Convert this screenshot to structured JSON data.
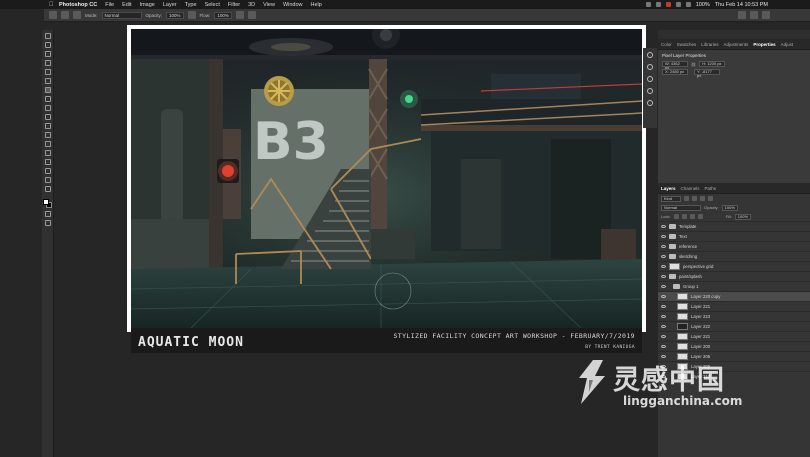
{
  "menubar": {
    "app_name": "Photoshop CC",
    "items": [
      "File",
      "Edit",
      "Image",
      "Layer",
      "Type",
      "Select",
      "Filter",
      "3D",
      "View",
      "Window",
      "Help"
    ],
    "battery": "100%",
    "clock": "Thu Feb 14  10:53 PM"
  },
  "options_bar": {
    "mode_label": "Mode:",
    "mode_value": "Normal",
    "opacity_label": "Opacity:",
    "opacity_value": "100%",
    "flow_label": "Flow:",
    "flow_value": "100%"
  },
  "artwork": {
    "title": "AQUATIC MOON",
    "subtitle": "STYLIZED FACILITY CONCEPT ART WORKSHOP - FEBRUARY/7/2019",
    "credit": "BY TRENT KANIUGA",
    "wall_number": "B3"
  },
  "panels": {
    "top_tabs": [
      "Color",
      "Swatches",
      "Libraries",
      "Adjustments",
      "Properties",
      "Adjust"
    ],
    "properties_title": "Pixel Layer Properties",
    "prop_w": "W: 4362 px",
    "prop_h": "H: 1200 px",
    "prop_x": "X: 2480 px",
    "prop_y": "Y: -8177 px",
    "layer_tabs": [
      "Layers",
      "Channels",
      "Paths"
    ],
    "kind_label": "Kind",
    "blend_mode": "Normal",
    "opacity_label": "Opacity:",
    "opacity_value": "100%",
    "lock_label": "Lock:",
    "fill_label": "Fill:",
    "fill_value": "100%",
    "layers": [
      {
        "name": "Template",
        "type": "folder"
      },
      {
        "name": "Text",
        "type": "folder"
      },
      {
        "name": "reference",
        "type": "folder"
      },
      {
        "name": "sketching",
        "type": "folder"
      },
      {
        "name": "perspective grid",
        "type": "layer"
      },
      {
        "name": "paint/splash",
        "type": "folder"
      },
      {
        "name": "Group 1",
        "type": "folder"
      },
      {
        "name": "Layer 220 copy",
        "type": "layer",
        "selected": true
      },
      {
        "name": "Layer 221",
        "type": "layer"
      },
      {
        "name": "Layer 223",
        "type": "layer"
      },
      {
        "name": "Layer 222",
        "type": "layer",
        "dark": true
      },
      {
        "name": "Layer 221",
        "type": "layer"
      },
      {
        "name": "Layer 200",
        "type": "layer"
      },
      {
        "name": "Layer 206",
        "type": "layer"
      },
      {
        "name": "Layer 209",
        "type": "layer"
      },
      {
        "name": "Layer 210",
        "type": "layer"
      }
    ]
  },
  "watermark": {
    "chinese": "灵感中国",
    "url": "lingganchina.com"
  }
}
